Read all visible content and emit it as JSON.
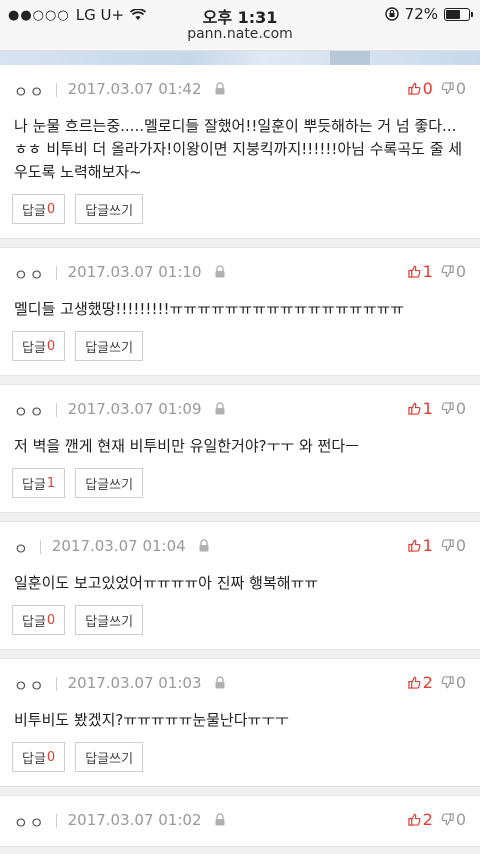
{
  "status": {
    "carrier": "LG U+",
    "time": "오후 1:31",
    "battery": "72%",
    "battery_level": 0.72,
    "url": "pann.nate.com"
  },
  "labels": {
    "reply": "답글",
    "write_reply": "답글쓰기"
  },
  "comments": [
    {
      "author": "ㅇㅇ",
      "date": "2017.03.07 01:42",
      "up": "0",
      "down": "0",
      "text": "나 눈물 흐르는중.....멜로디들 잘했어!!일훈이 뿌듯해하는 거 넘 좋다...ㅎㅎ 비투비 더 올라가자!이왕이면 지붕킥까지!!!!!!아님 수록곡도 줄 세우도록 노력해보자~",
      "replies": "0"
    },
    {
      "author": "ㅇㅇ",
      "date": "2017.03.07 01:10",
      "up": "1",
      "down": "0",
      "text": "멜디들 고생했땅!!!!!!!!!ㅠㅠㅠㅠㅠㅠㅠㅠㅠㅠㅠㅠㅠㅠㅠㅠㅠ",
      "replies": "0"
    },
    {
      "author": "ㅇㅇ",
      "date": "2017.03.07 01:09",
      "up": "1",
      "down": "0",
      "text": "저 벽을 깬게 현재 비투비만 유일한거야?ㅜㅜ 와 쩐다ㅡ",
      "replies": "1"
    },
    {
      "author": "ㅇ",
      "date": "2017.03.07 01:04",
      "up": "1",
      "down": "0",
      "text": "일훈이도 보고있었어ㅠㅠㅠㅠ아 진짜 행복해ㅠㅠ",
      "replies": "0"
    },
    {
      "author": "ㅇㅇ",
      "date": "2017.03.07 01:03",
      "up": "2",
      "down": "0",
      "text": "비투비도 봤겠지?ㅠㅠㅠㅠㅠ눈물난다ㅠㅜㅜ",
      "replies": "0"
    },
    {
      "author": "ㅇㅇ",
      "date": "2017.03.07 01:02",
      "up": "2",
      "down": "0",
      "text": "",
      "replies": ""
    }
  ]
}
